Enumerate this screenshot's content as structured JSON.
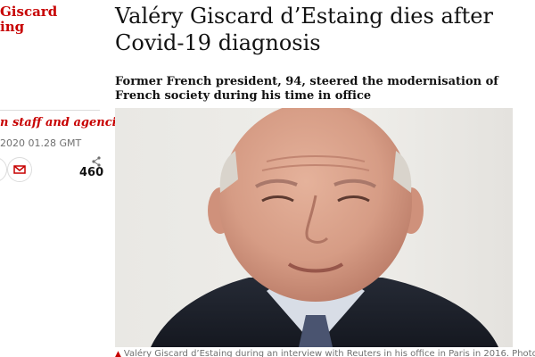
{
  "section": {
    "title_line1": "Giscard",
    "title_line2": "ing"
  },
  "byline": "n staff and agencies",
  "date": "2020 01.28 GMT",
  "share": {
    "count": "460"
  },
  "article": {
    "headline": "Valéry Giscard d’Estaing dies after Covid-19 diagnosis",
    "standfirst": "Former French president, 94, steered the modernisation of French society during his time in office",
    "caption": "Valéry Giscard d’Estaing during an interview with Reuters in his office in Paris in 2016. Photograph: Benoît"
  },
  "colors": {
    "accent": "#c70000",
    "text": "#121212",
    "muted": "#707070",
    "rule": "#dcdcdc"
  },
  "icons": [
    "email-icon",
    "share-icon",
    "caption-triangle-icon"
  ]
}
